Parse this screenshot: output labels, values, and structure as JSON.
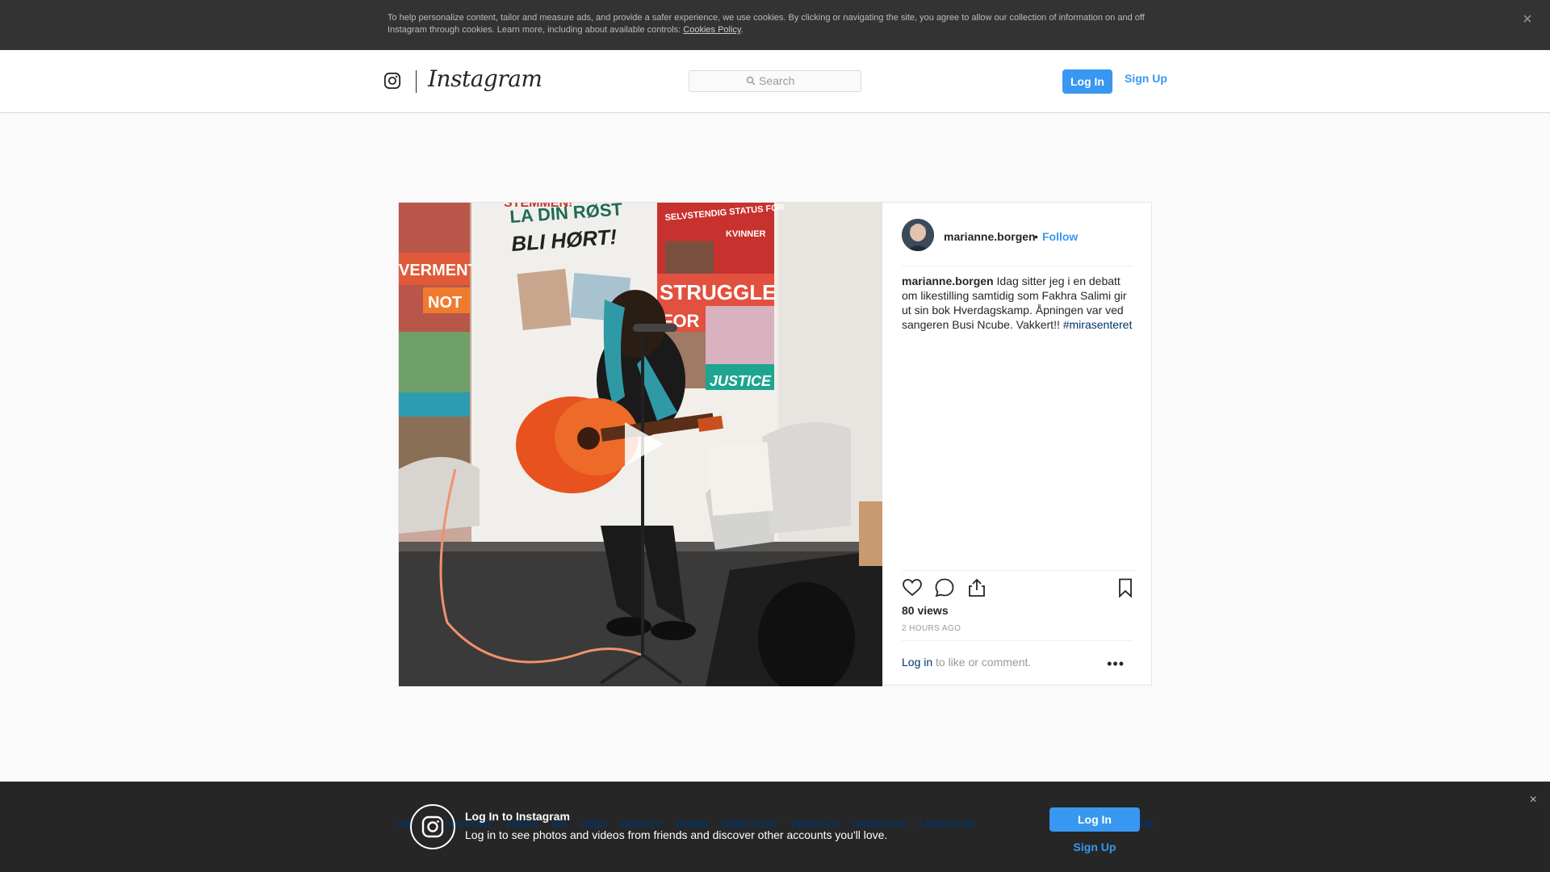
{
  "cookie_banner": {
    "text": "To help personalize content, tailor and measure ads, and provide a safer experience, we use cookies. By clicking or navigating the site, you agree to allow our collection of information on and off Instagram through cookies. Learn more, including about available controls:",
    "link_label": "Cookies Policy",
    "link_suffix": ".",
    "close_icon": "close-icon"
  },
  "header": {
    "wordmark": "Instagram",
    "search_placeholder": "Search",
    "login_label": "Log In",
    "signup_label": "Sign Up"
  },
  "post": {
    "username": "marianne.borgen",
    "dot": "•",
    "follow_label": "Follow",
    "caption_user": "marianne.borgen",
    "caption_text": " Idag sitter jeg i en debatt om likestilling samtidig som Fakhra Salimi gir ut sin bok Hverdagskamp. Åpningen var ved sangeren Busi Ncube. Vakkert!! ",
    "hashtag": "#mirasenteret",
    "views": "80 views",
    "time": "2 hours ago",
    "login_link": "Log in",
    "login_rest": " to like or comment.",
    "more": "•••",
    "media_signs": {
      "sign1": "LA DIN RØST",
      "sign2": "BLI HØRT!",
      "sign3": "STRUGGLE",
      "sign4": "FOR",
      "sign5": "JUSTICE",
      "sign6": "VERMENT",
      "sign7": "NOT",
      "sign8": "STEMMEN!",
      "sign9": "SELVSTENDIG STATUS FOR",
      "sign10": "KVINNER"
    }
  },
  "footer": {
    "left_partial": "AB",
    "right_partial": "AM"
  },
  "login_banner": {
    "title": "Log In to Instagram",
    "subtitle": "Log in to see photos and videos from friends and discover other accounts you'll love.",
    "login_label": "Log In",
    "signup_label": "Sign Up",
    "close": "×"
  },
  "footer_links": [
    "ABOUT US",
    "SUPPORT",
    "PRESS",
    "API",
    "JOBS",
    "PRIVACY",
    "TERMS",
    "DIRECTORY",
    "PROFILES",
    "HASHTAGS",
    "LANGUAGE"
  ],
  "colors": {
    "accent": "#3897f0",
    "link_dark": "#003569",
    "banner_bg": "#333333"
  }
}
